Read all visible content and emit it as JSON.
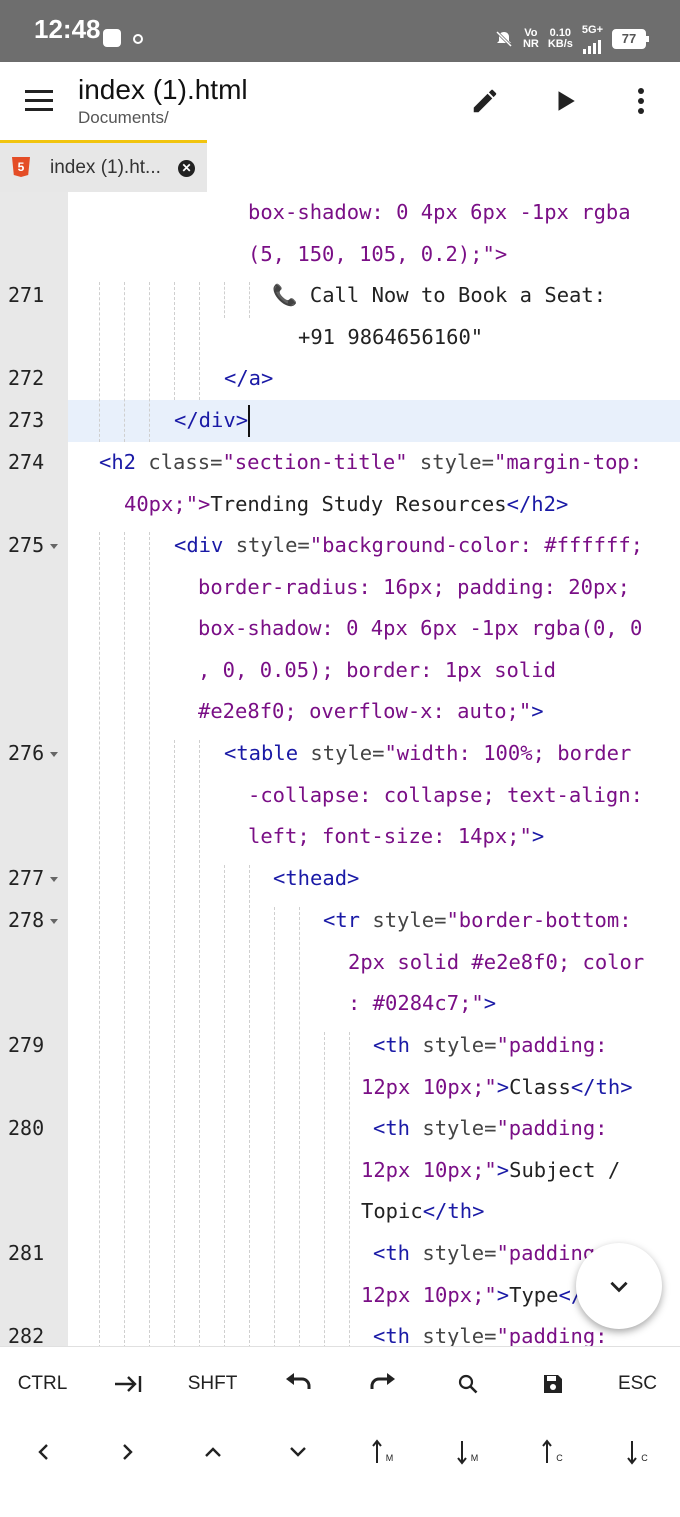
{
  "status": {
    "time": "12:48",
    "volte": [
      "Vo",
      "NR"
    ],
    "speed": [
      "0.10",
      "KB/s"
    ],
    "network": "5G+",
    "battery": "77"
  },
  "appbar": {
    "title": "index (1).html",
    "path": "Documents/",
    "icons": [
      "menu-icon",
      "edit-icon",
      "play-icon",
      "more-vert-icon"
    ]
  },
  "tab": {
    "icon": "5",
    "label": "index (1).ht..."
  },
  "code": {
    "cont_0a": "box-shadow: 0 4px 6px -1px rgba",
    "cont_0b": "(5, 150, 105, 0.2);\">",
    "ln271": "271",
    "l271a": "📞 Call Now to Book a Seat:",
    "l271b": "+91 9864656160\"",
    "ln272": "272",
    "l272": "</a>",
    "ln273": "273",
    "l273": "</div>",
    "ln274": "274",
    "l274a_tag": "<h2",
    "l274a_attr": " class=",
    "l274a_val": "\"section-title\"",
    "l274a_attr2": " style=",
    "l274a_val2": "\"margin-top:",
    "l274b_val": "40px;\">",
    "l274b_text": "Trending Study Resources",
    "l274b_end": "</h2>",
    "ln275": "275",
    "l275a_tag": "<div",
    "l275a_attr": " style=",
    "l275a_val": "\"background-color: #ffffff;",
    "l275b": "border-radius: 16px; padding: 20px;",
    "l275c": "box-shadow: 0 4px 6px -1px rgba(0, 0",
    "l275d": ", 0, 0.05); border: 1px solid",
    "l275e_val": "#e2e8f0; overflow-x: auto;\"",
    "l275e_end": ">",
    "ln276": "276",
    "l276a_tag": "<table",
    "l276a_attr": " style=",
    "l276a_val": "\"width: 100%; border",
    "l276b": "-collapse: collapse; text-align:",
    "l276c_val": "left; font-size: 14px;\"",
    "l276c_end": ">",
    "ln277": "277",
    "l277": "<thead>",
    "ln278": "278",
    "l278a_tag": "<tr",
    "l278a_attr": " style=",
    "l278a_val": "\"border-bottom:",
    "l278b": "2px solid #e2e8f0; color",
    "l278c_val": ": #0284c7;\"",
    "l278c_end": ">",
    "ln279": "279",
    "l279a_tag": "<th",
    "l279a_attr": " style=",
    "l279a_val": "\"padding:",
    "l279b_val": "12px 10px;\"",
    "l279b_gt": ">",
    "l279b_text": "Class",
    "l279b_end": "</th>",
    "ln280": "280",
    "l280a_tag": "<th",
    "l280a_attr": " style=",
    "l280a_val": "\"padding:",
    "l280b_val": "12px 10px;\"",
    "l280b_gt": ">",
    "l280b_text": "Subject /",
    "l280c_text": "Topic",
    "l280c_end": "</th>",
    "ln281": "281",
    "l281a_tag": "<th",
    "l281a_attr": " style=",
    "l281a_val": "\"padding:",
    "l281b_val": "12px 10px;\"",
    "l281b_gt": ">",
    "l281b_text": "Type",
    "l281b_end": "</",
    "ln282": "282",
    "l282a_tag": "<th",
    "l282a_attr": " style=",
    "l282a_val": "\"padding:"
  },
  "keys": {
    "row1": [
      "CTRL",
      "→|",
      "SHFT",
      "undo-icon",
      "redo-icon",
      "search-icon",
      "save-icon",
      "ESC"
    ],
    "ctrl": "CTRL",
    "shft": "SHFT",
    "esc": "ESC",
    "m": "M",
    "c": "C"
  }
}
